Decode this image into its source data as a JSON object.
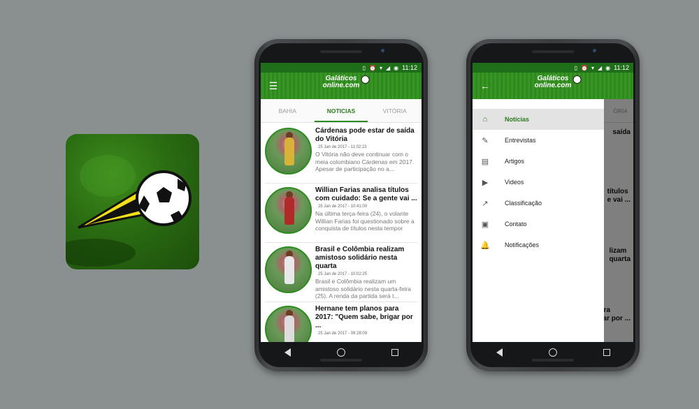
{
  "status": {
    "time": "11:12"
  },
  "brand": {
    "line1": "Galáticos",
    "line2": "online.com"
  },
  "tabs": [
    {
      "label": "BAHIA"
    },
    {
      "label": "NOTICIAS"
    },
    {
      "label": "VITÓRIA"
    }
  ],
  "news": [
    {
      "title": "Cárdenas pode estar de saída do Vitória",
      "date": "25 Jan de 2017 - 11:02:23",
      "excerpt": "O Vitória não deve continuar com o meia colombiano Cárdenas em 2017. Apesar de participação no a..."
    },
    {
      "title": "Willian Farias analisa títulos com cuidado: Se a gente vai ...",
      "date": "25 Jan de 2017 - 10:41:00",
      "excerpt": "Na última terça-feira (24), o volante Willian Farias foi questionado sobre a conquista de títulos nesta tempor"
    },
    {
      "title": "Brasil e Colômbia realizam amistoso solidário nesta quarta",
      "date": "25 Jan de 2017 - 10:02:25",
      "excerpt": "Brasil e Colômbia realizam um amistoso solidário nesta quarta-feira (25). A renda da partida será t..."
    },
    {
      "title": "Hernane tem planos para 2017: \"Quem sabe, brigar por ...",
      "date": "25 Jan de 2017 - 09:28:09",
      "excerpt": ""
    }
  ],
  "drawer": {
    "items": [
      {
        "label": "Notícias",
        "icon": "home-icon"
      },
      {
        "label": "Entrevistas",
        "icon": "pencil-icon"
      },
      {
        "label": "Artigos",
        "icon": "document-icon"
      },
      {
        "label": "Videos",
        "icon": "video-library-icon"
      },
      {
        "label": "Classificação",
        "icon": "trending-icon"
      },
      {
        "label": "Contato",
        "icon": "contact-card-icon"
      },
      {
        "label": "Notificações",
        "icon": "bell-icon"
      }
    ]
  },
  "behind": {
    "titles": [
      "saída",
      "títulos\ne vai ...",
      "lizam\nquarta",
      "s para\nbrigar por ..."
    ],
    "tab": "ÓRIA"
  },
  "colors": {
    "accent": "#2a8a1e",
    "status_bar": "#1f6e1a",
    "background": "#8a9090"
  }
}
